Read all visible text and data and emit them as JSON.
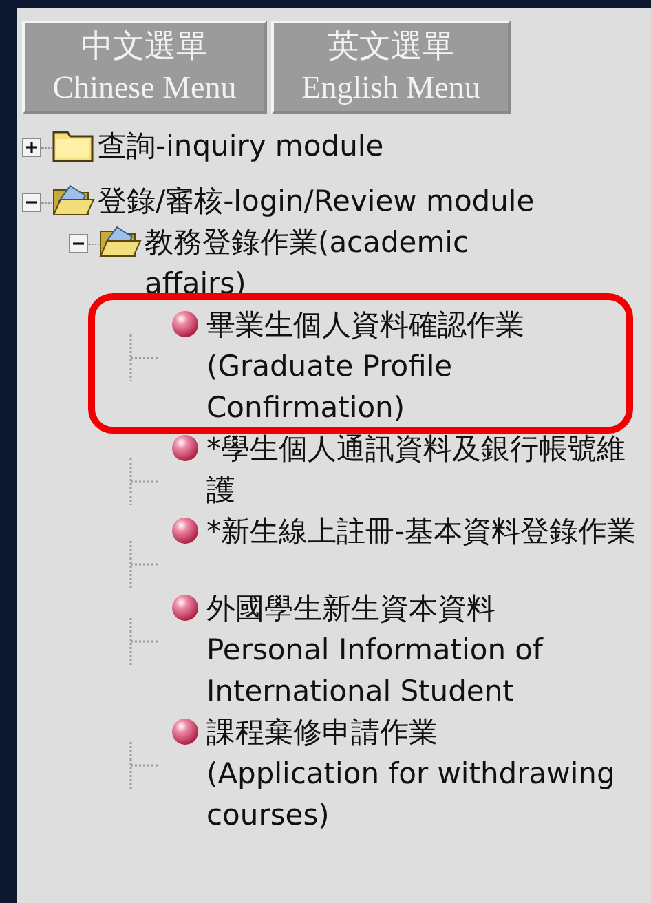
{
  "menu_buttons": [
    {
      "label_zh": "中文選單",
      "label_en": "Chinese Menu"
    },
    {
      "label_zh": "英文選單",
      "label_en": "English Menu"
    }
  ],
  "tree": [
    {
      "kind": "folder",
      "label": "查詢-inquiry module",
      "expanded": false
    },
    {
      "kind": "folder",
      "label": "登錄/審核-login/Review module",
      "expanded": true,
      "children": [
        {
          "kind": "folder",
          "label": "教務登錄作業(academic\naffairs)",
          "expanded": true,
          "children": [
            {
              "kind": "item",
              "label": "畢業生個人資料確認作業\n(Graduate Profile Confirmation)",
              "highlighted": true
            },
            {
              "kind": "item",
              "label": "*學生個人通訊資料及銀行帳號維護",
              "highlighted": false
            },
            {
              "kind": "item",
              "label": "*新生線上註冊-基本資料登錄作業",
              "highlighted": false
            },
            {
              "kind": "item",
              "label": "外國學生新生資本資料\nPersonal Information of International Student",
              "highlighted": false
            },
            {
              "kind": "item",
              "label": "課程棄修申請作業\n(Application for withdrawing courses)",
              "highlighted": false
            }
          ]
        }
      ]
    }
  ]
}
